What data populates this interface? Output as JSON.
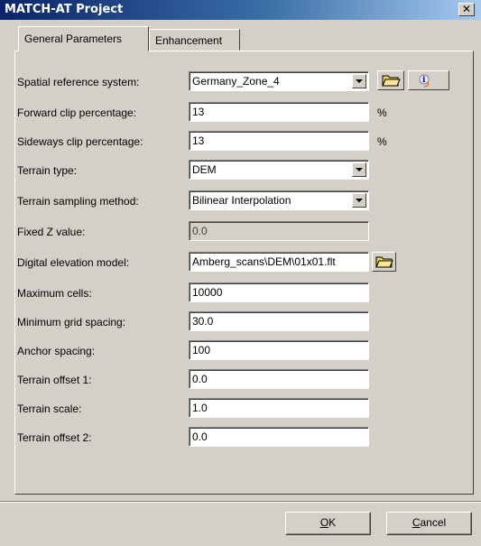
{
  "window": {
    "title": "MATCH-AT Project",
    "close_glyph": "✕"
  },
  "tabs": [
    {
      "label": "General Parameters",
      "active": true
    },
    {
      "label": "Enhancement",
      "active": false
    }
  ],
  "fields": {
    "spatial_ref": {
      "label": "Spatial reference system:",
      "value": "Germany_Zone_4"
    },
    "forward_clip": {
      "label": "Forward clip percentage:",
      "value": "13",
      "unit": "%"
    },
    "sideways_clip": {
      "label": "Sideways clip percentage:",
      "value": "13",
      "unit": "%"
    },
    "terrain_type": {
      "label": "Terrain type:",
      "value": "DEM"
    },
    "sampling_method": {
      "label": "Terrain sampling method:",
      "value": "Bilinear Interpolation"
    },
    "fixed_z": {
      "label": "Fixed Z value:",
      "value": "0.0"
    },
    "dem": {
      "label": "Digital elevation model:",
      "value": "Amberg_scans\\DEM\\01x01.flt"
    },
    "max_cells": {
      "label": "Maximum cells:",
      "value": "10000"
    },
    "min_grid": {
      "label": "Minimum grid spacing:",
      "value": "30.0"
    },
    "anchor": {
      "label": "Anchor spacing:",
      "value": "100"
    },
    "offset1": {
      "label": "Terrain offset 1:",
      "value": "0.0"
    },
    "scale": {
      "label": "Terrain scale:",
      "value": "1.0"
    },
    "offset2": {
      "label": "Terrain offset 2:",
      "value": "0.0"
    }
  },
  "buttons": {
    "ok": {
      "mnemonic": "O",
      "rest": "K"
    },
    "cancel": {
      "mnemonic": "C",
      "rest": "ancel"
    }
  },
  "icons": {
    "browse": "folder-open-icon",
    "info": "info-icon",
    "dropdown": "chevron-down-icon"
  },
  "colors": {
    "titlebar_start": "#0a246a",
    "titlebar_end": "#a6caf0",
    "face": "#d4d0c8",
    "folder": "#f0d060"
  }
}
